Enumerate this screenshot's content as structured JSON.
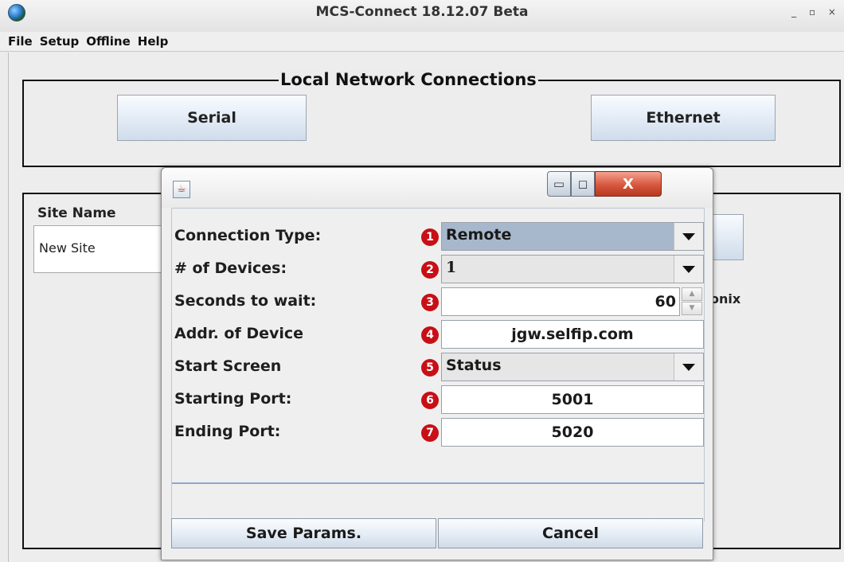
{
  "window": {
    "title": "MCS-Connect 18.12.07 Beta",
    "controls": "_ ▫ ×"
  },
  "menu": [
    "File",
    "Setup",
    "Offline",
    "Help"
  ],
  "local_network": {
    "title": "Local Network Connections",
    "serial_label": "Serial",
    "ethernet_label": "Ethernet"
  },
  "site": {
    "label": "Site Name",
    "value": "New Site",
    "partial_text_right": "onix"
  },
  "dialog": {
    "icon": "java-cup-icon",
    "close_glyph": "X",
    "min_glyph": "▭",
    "max_glyph": "◻",
    "rows": [
      {
        "label": "Connection Type:",
        "badge": "1",
        "type": "combo",
        "value": "Remote",
        "selected": true
      },
      {
        "label": "# of Devices:",
        "badge": "2",
        "type": "combo",
        "value": "1",
        "selected": false
      },
      {
        "label": "Seconds to wait:",
        "badge": "3",
        "type": "spinner",
        "value": "60"
      },
      {
        "label": "Addr. of Device",
        "badge": "4",
        "type": "field",
        "value": "jgw.selfip.com"
      },
      {
        "label": "Start Screen",
        "badge": "5",
        "type": "combo",
        "value": "Status",
        "selected": false
      },
      {
        "label": "Starting Port:",
        "badge": "6",
        "type": "field",
        "value": "5001"
      },
      {
        "label": "Ending Port:",
        "badge": "7",
        "type": "field",
        "value": "5020"
      }
    ],
    "save_label": "Save Params.",
    "cancel_label": "Cancel"
  },
  "colors": {
    "badge": "#c80f16",
    "selected_combo": "#a8b8cc",
    "close_button": "#d6573e"
  }
}
